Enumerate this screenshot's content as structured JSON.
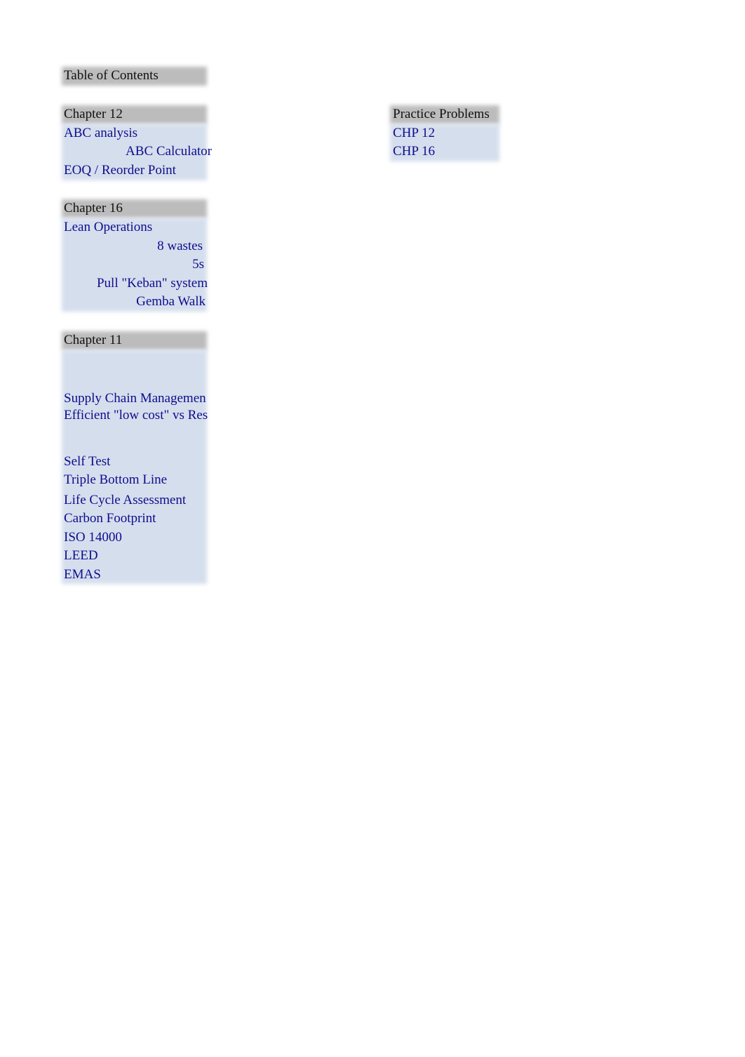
{
  "toc": {
    "title": "Table of Contents"
  },
  "chapter12": {
    "header": "Chapter 12",
    "items": [
      "ABC analysis",
      "ABC Calculator",
      "EOQ / Reorder Point"
    ]
  },
  "chapter16": {
    "header": "Chapter 16",
    "items": [
      "Lean Operations",
      "8 wastes",
      "5s",
      "Pull \"Keban\" system",
      "Gemba Walk"
    ]
  },
  "chapter11": {
    "header": "Chapter 11",
    "items": [
      "Supply Chain Managemen",
      "Efficient \"low cost\" vs Res",
      "Self Test",
      "Triple Bottom Line",
      "Life Cycle Assessment",
      "Carbon Footprint",
      "ISO 14000",
      "LEED",
      "EMAS"
    ]
  },
  "practice": {
    "header": "Practice Problems",
    "items": [
      "CHP 12",
      "CHP 16"
    ]
  },
  "colors": {
    "header_bg": "#bcbcbc",
    "row_bg": "#d5deed",
    "link": "#0d0d8c"
  }
}
